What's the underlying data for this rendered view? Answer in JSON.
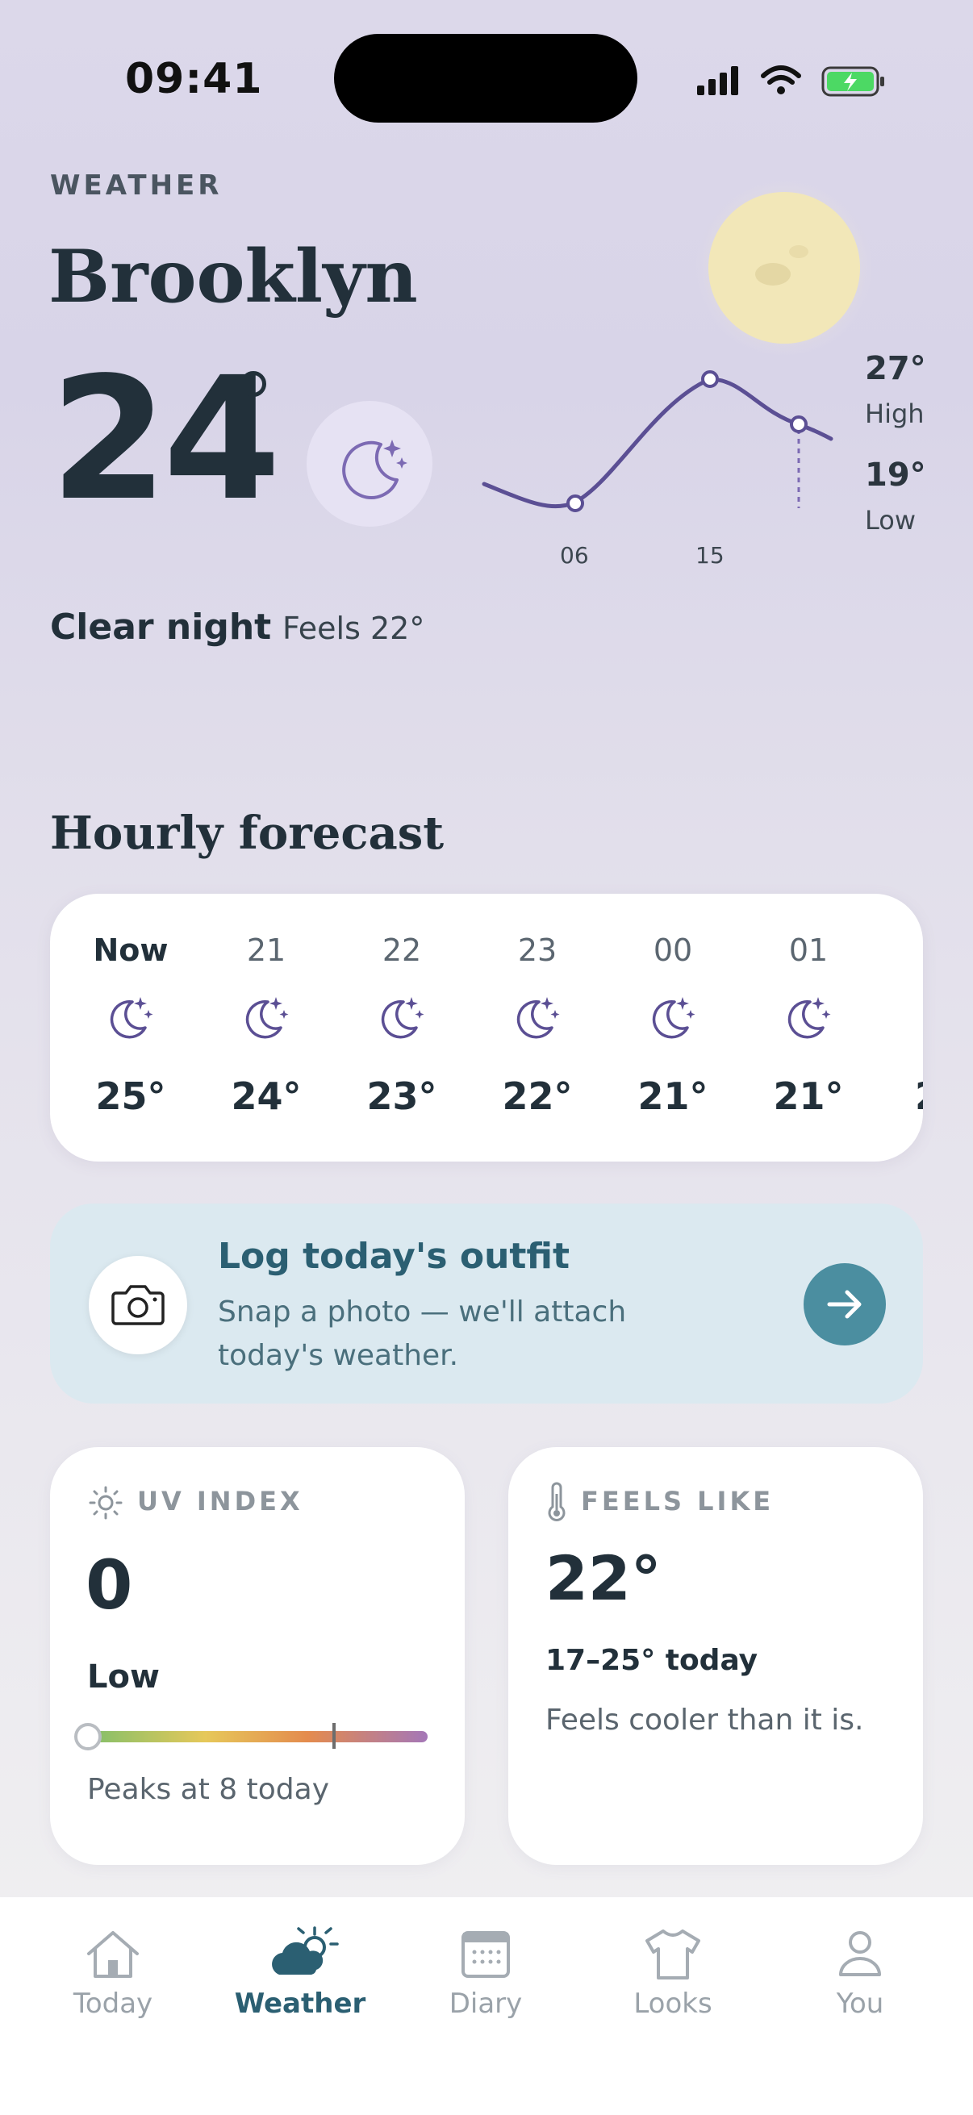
{
  "status_bar": {
    "time": "09:41"
  },
  "header": {
    "eyebrow": "WEATHER",
    "city": "Brooklyn",
    "temperature": "24",
    "condition": "Clear night",
    "feels_like": "Feels 22°",
    "high_value": "27°",
    "high_label": "High",
    "low_value": "19°",
    "low_label": "Low",
    "chart_ticks": [
      "06",
      "15"
    ]
  },
  "hourly": {
    "title": "Hourly forecast",
    "items": [
      {
        "label": "Now",
        "temp": "25°",
        "icon": "moon-stars-icon"
      },
      {
        "label": "21",
        "temp": "24°",
        "icon": "moon-stars-icon"
      },
      {
        "label": "22",
        "temp": "23°",
        "icon": "moon-stars-icon"
      },
      {
        "label": "23",
        "temp": "22°",
        "icon": "moon-stars-icon"
      },
      {
        "label": "00",
        "temp": "21°",
        "icon": "moon-stars-icon"
      },
      {
        "label": "01",
        "temp": "21°",
        "icon": "moon-stars-icon"
      },
      {
        "label": "",
        "temp": "2",
        "icon": ""
      }
    ]
  },
  "outfit": {
    "title": "Log today's outfit",
    "subtitle": "Snap a photo — we'll attach today's weather."
  },
  "uv": {
    "eyebrow": "UV INDEX",
    "value": "0",
    "level": "Low",
    "peak": "Peaks at 8 today"
  },
  "feels": {
    "eyebrow": "FEELS LIKE",
    "value": "22°",
    "range": "17–25° today",
    "note": "Feels cooler than it is."
  },
  "tabs": [
    {
      "label": "Today",
      "icon": "house-icon",
      "active": false
    },
    {
      "label": "Weather",
      "icon": "cloud-sun-icon",
      "active": true
    },
    {
      "label": "Diary",
      "icon": "calendar-icon",
      "active": false
    },
    {
      "label": "Looks",
      "icon": "tshirt-icon",
      "active": false
    },
    {
      "label": "You",
      "icon": "person-icon",
      "active": false
    }
  ],
  "colors": {
    "accent": "#5b4f94",
    "teal": "#2b5f72",
    "banner": "#dbe9f0"
  }
}
